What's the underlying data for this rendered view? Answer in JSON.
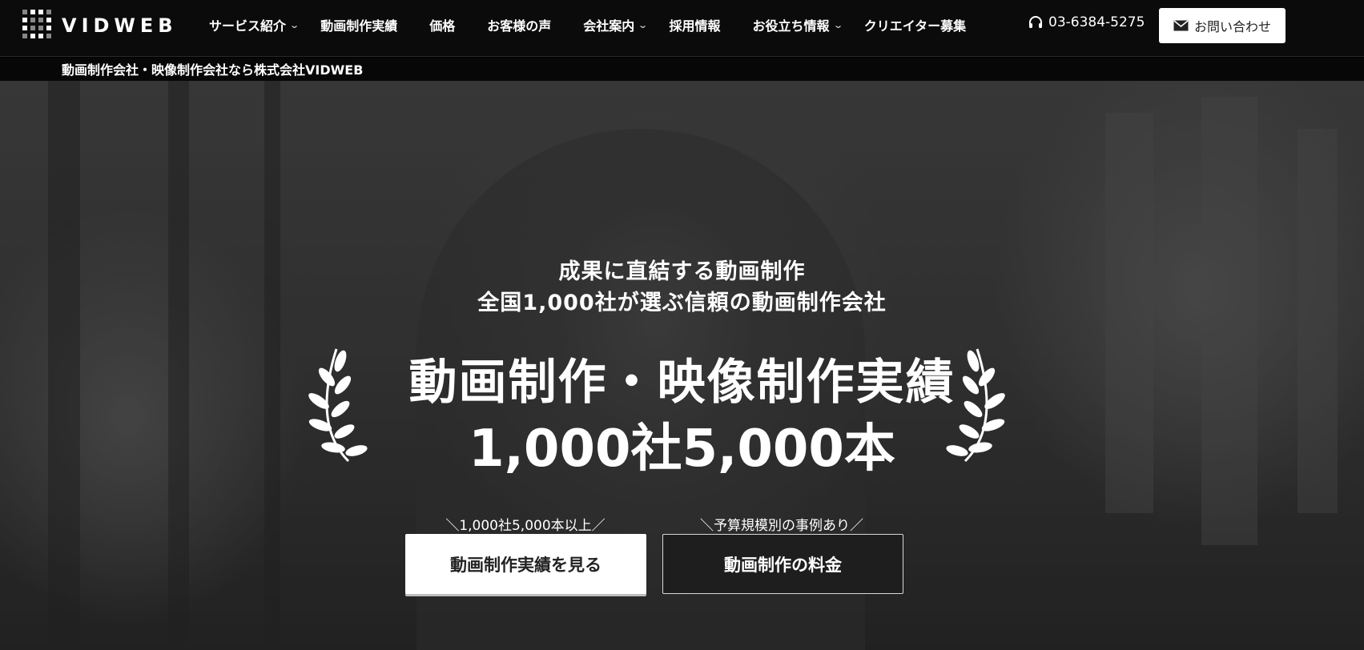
{
  "header": {
    "logo_text": "VIDWEB",
    "nav": [
      {
        "label": "サービス紹介",
        "has_dropdown": true
      },
      {
        "label": "動画制作実績",
        "has_dropdown": false
      },
      {
        "label": "価格",
        "has_dropdown": false
      },
      {
        "label": "お客様の声",
        "has_dropdown": false
      },
      {
        "label": "会社案内",
        "has_dropdown": true
      },
      {
        "label": "採用情報",
        "has_dropdown": false
      },
      {
        "label": "お役立ち情報",
        "has_dropdown": true
      },
      {
        "label": "クリエイター募集",
        "has_dropdown": false
      }
    ],
    "phone": "03-6384-5275",
    "contact_label": "お問い合わせ"
  },
  "subbar": {
    "text": "動画制作会社・映像制作会社なら株式会社VIDWEB"
  },
  "hero": {
    "tagline_1": "成果に直結する動画制作",
    "tagline_2": "全国1,000社が選ぶ信頼の動画制作会社",
    "headline": "動画制作・映像制作実績",
    "headline_count": "1,000社5,000本",
    "cta_primary_note": "＼1,000社5,000本以上／",
    "cta_primary_label": "動画制作実績を見る",
    "cta_secondary_note": "＼予算規模別の事例あり／",
    "cta_secondary_label": "動画制作の料金"
  },
  "colors": {
    "header_bg": "#0b0b0b",
    "primary_button_bg": "#ffffff",
    "secondary_button_bg": "#1e1e1e"
  },
  "icons": {
    "phone": "headset-icon",
    "contact": "envelope-icon",
    "dropdown": "chevron-down-icon",
    "laurel": "laurel-wreath-icon"
  }
}
